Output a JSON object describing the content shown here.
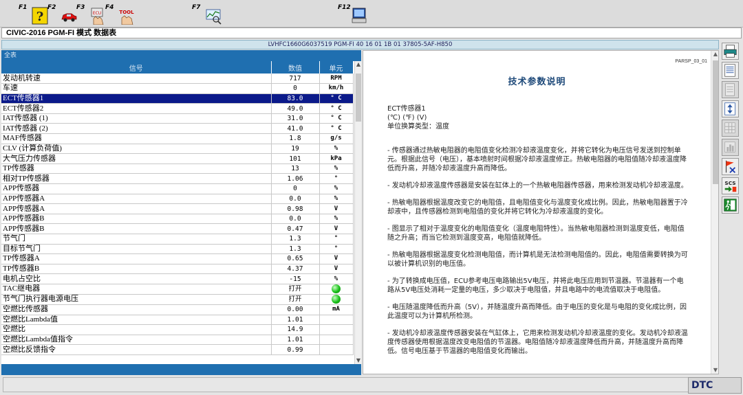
{
  "toolbar": {
    "keys": [
      {
        "label": "F1",
        "icon": "help-icon"
      },
      {
        "label": "F2",
        "icon": "car-icon"
      },
      {
        "label": "F3",
        "icon": "ecu-hand-icon"
      },
      {
        "label": "F4",
        "icon": "tool-hand-icon"
      },
      {
        "label": "F7",
        "icon": "graph-magnifier-icon"
      },
      {
        "label": "F12",
        "icon": "print-screen-icon"
      }
    ],
    "tool_text": "TOOL"
  },
  "mode_bar": "CIVIC-2016 PGM-FI 模式 数据表",
  "vin_bar": "LVHFC1660G6037519  PGM-FI  40 16 01 1B 01  37805-5AF-H850",
  "left_panel": {
    "title": "全表",
    "columns": {
      "signal": "信号",
      "value": "数值",
      "unit": "单元"
    },
    "rows": [
      {
        "signal": "发动机转速",
        "value": "717",
        "unit": "RPM"
      },
      {
        "signal": "车速",
        "value": "0",
        "unit": "km/h"
      },
      {
        "signal": "ECT传感器1",
        "value": "83.0",
        "unit": "° C",
        "selected": true
      },
      {
        "signal": "ECT传感器2",
        "value": "49.0",
        "unit": "° C"
      },
      {
        "signal": "IAT传感器 (1)",
        "value": "31.0",
        "unit": "° C"
      },
      {
        "signal": "IAT传感器 (2)",
        "value": "41.0",
        "unit": "° C"
      },
      {
        "signal": "MAF传感器",
        "value": "1.8",
        "unit": "g/s"
      },
      {
        "signal": "CLV (计算负荷值)",
        "value": "19",
        "unit": "%"
      },
      {
        "signal": "大气压力传感器",
        "value": "101",
        "unit": "kPa"
      },
      {
        "signal": "TP传感器",
        "value": "13",
        "unit": "%"
      },
      {
        "signal": "相对TP传感器",
        "value": "1.06",
        "unit": "°"
      },
      {
        "signal": "APP传感器",
        "value": "0",
        "unit": "%"
      },
      {
        "signal": "APP传感器A",
        "value": "0.0",
        "unit": "%"
      },
      {
        "signal": "APP传感器A",
        "value": "0.98",
        "unit": "V"
      },
      {
        "signal": "APP传感器B",
        "value": "0.0",
        "unit": "%"
      },
      {
        "signal": "APP传感器B",
        "value": "0.47",
        "unit": "V"
      },
      {
        "signal": "节气门",
        "value": "1.3",
        "unit": "°"
      },
      {
        "signal": "目标节气门",
        "value": "1.3",
        "unit": "°"
      },
      {
        "signal": "TP传感器A",
        "value": "0.65",
        "unit": "V"
      },
      {
        "signal": "TP传感器B",
        "value": "4.37",
        "unit": "V"
      },
      {
        "signal": "电机占空比",
        "value": "-15",
        "unit": "%"
      },
      {
        "signal": "TAC继电器",
        "value": "打开",
        "unit": "",
        "indicator": true
      },
      {
        "signal": "节气门执行器电源电压",
        "value": "打开",
        "unit": "",
        "indicator": true
      },
      {
        "signal": "空燃比传感器",
        "value": "0.00",
        "unit": "mA"
      },
      {
        "signal": "空燃比Lambda值",
        "value": "1.01",
        "unit": ""
      },
      {
        "signal": "空燃比",
        "value": "14.9",
        "unit": ""
      },
      {
        "signal": "空燃比Lambda值指令",
        "value": "1.01",
        "unit": ""
      },
      {
        "signal": "空燃比反馈指令",
        "value": "0.99",
        "unit": ""
      }
    ]
  },
  "doc": {
    "id": "PARSP_03_01",
    "title": "技术参数说明",
    "signal": "ECT传感器1",
    "units": "(℃)  (℉)  (V)",
    "conversion": "单位换算类型：温度",
    "paragraphs": [
      "- 传感器通过热敏电阻器的电阻值变化检测冷却液温度变化，并将它转化为电压信号发送到控制单元。根据此信号（电压），基本喷射时间根据冷却液温度修正。热敏电阻器的电阻值随冷却液温度降低而升高，并随冷却液温度升高而降低。",
      "- 发动机冷却液温度传感器是安装在缸体上的一个热敏电阻器传感器，用来检测发动机冷却液温度。",
      "- 热敏电阻器根据温度改变它的电阻值，且电阻值变化与温度变化成比例。因此，热敏电阻器置于冷却液中，且传感器检测到电阻值的变化并将它转化为冷却液温度的变化。",
      "- 图显示了相对于温度变化的电阻值变化（温度电阻特性）。当热敏电阻器检测到温度变低，电阻值随之升高；而当它检测到温度变高，电阻值就降低。",
      "- 热敏电阻器根据温度变化检测电阻值，而计算机是无法检测电阻值的。因此，电阻值需要转换为可以被计算机识别的电压值。",
      "- 为了转换成电压值，ECU参考电压电路输出5V电压，并将此电压应用到节温器。节温器有一个电路从5V电压处消耗一定量的电压，多少取决于电阻值，并且电路中的电流值取决于电阻值。",
      "- 电压随温度降低而升高（5V），并随温度升高而降低。由于电压的变化是与电阻的变化成比例，因此温度可以为计算机所检测。",
      "- 发动机冷却液温度传感器安装在气缸体上，它用来检测发动机冷却液温度的变化。发动机冷却液温度传感器使用根据温度改变电阻值的节温器。电阻值随冷却液温度降低而升高，并随温度升高而降低。信号电压基于节温器的电阻值变化而输出。"
    ]
  },
  "right_toolbar": [
    {
      "icon": "printer-icon",
      "enabled": true
    },
    {
      "icon": "list-view-icon",
      "enabled": true
    },
    {
      "icon": "document-icon",
      "enabled": false
    },
    {
      "icon": "sort-arrows-icon",
      "enabled": true
    },
    {
      "icon": "grid-icon",
      "enabled": false
    },
    {
      "icon": "chart-icon",
      "enabled": false
    },
    {
      "icon": "flag-x-icon",
      "enabled": true
    },
    {
      "icon": "scs-icon",
      "enabled": true,
      "text": "SCS"
    },
    {
      "icon": "exit-icon",
      "enabled": true
    }
  ],
  "status_bar": {
    "dtc_label": "DTC"
  },
  "colors": {
    "header_blue": "#1f6fb0",
    "selected_row": "#0b1a8a",
    "title_blue": "#1f4a7a",
    "indicator_green": "#18c018"
  }
}
